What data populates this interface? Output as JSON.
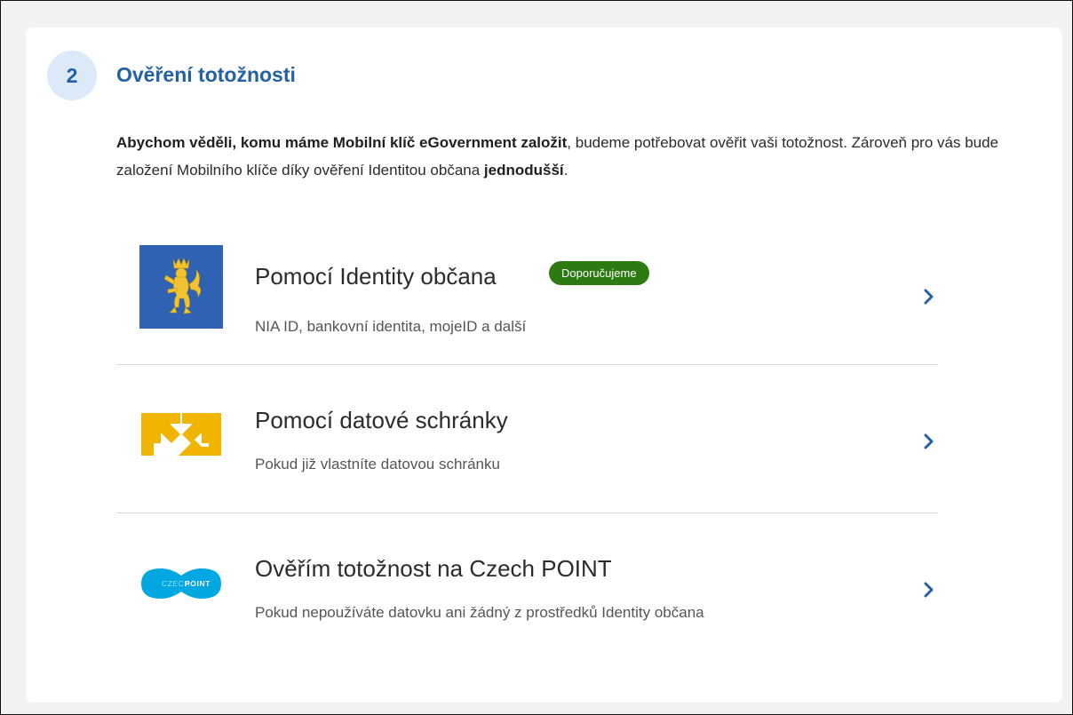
{
  "step": {
    "number": "2",
    "title": "Ověření totožnosti"
  },
  "intro": {
    "bold_lead": "Abychom věděli, komu máme Mobilní klíč eGovernment založit",
    "text_mid": ", budeme potřebovat ověřit vaši totožnost. Zároveň pro vás bude založení Mobilního klíče díky ověření Identitou občana ",
    "bold_end": "jednodušší",
    "text_end": "."
  },
  "options": [
    {
      "title": "Pomocí Identity občana",
      "badge": "Doporučujeme",
      "subtitle": "NIA ID, bankovní identita, mojeID a další",
      "icon": "czech-lion-emblem-icon",
      "icon_bg": "#2f62b3"
    },
    {
      "title": "Pomocí datové schránky",
      "subtitle": "Pokud již vlastníte datovou schránku",
      "icon": "datova-schranka-arrows-icon",
      "icon_color": "#f1b400"
    },
    {
      "title": "Ověřím totožnost na Czech POINT",
      "subtitle": "Pokud nepoužíváte datovku ani žádný z prostředků Identity občana",
      "icon": "czech-point-logo-icon",
      "icon_color": "#00a7e1",
      "logo_text_a": "CZECH",
      "logo_text_b": "POINT"
    }
  ],
  "colors": {
    "accent_blue": "#2362a2",
    "badge_green": "#2d7a13",
    "step_circle_bg": "#dbe9f8"
  }
}
